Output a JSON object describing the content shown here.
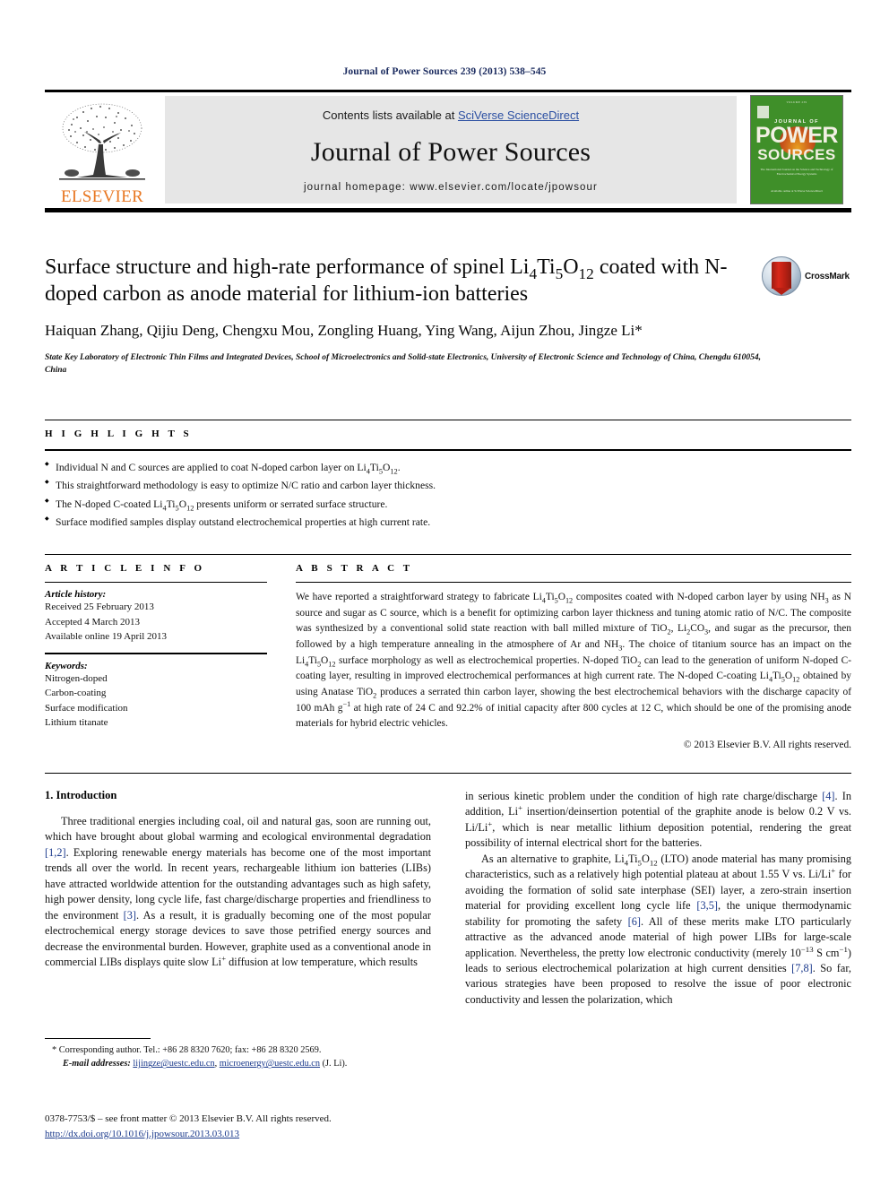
{
  "running_head": "Journal of Power Sources 239 (2013) 538–545",
  "masthead": {
    "contents_prefix": "Contents lists available at ",
    "contents_link": "SciVerse ScienceDirect",
    "journal_name": "Journal of Power Sources",
    "homepage": "journal homepage: www.elsevier.com/locate/jpowsour",
    "publisher_wordmark": "ELSEVIER",
    "cover": {
      "journal_of": "JOURNAL OF",
      "power": "POWER",
      "sources": "SOURCES",
      "blurb": "The International Journal on the Science and Technology of Electrochemical Energy Systems",
      "foot": "Available online at\nSciVerse ScienceDirect"
    }
  },
  "title": "Surface structure and high-rate performance of spinel Li4Ti5O12 coated with N-doped carbon as anode material for lithium-ion batteries",
  "authors": "Haiquan Zhang, Qijiu Deng, Chengxu Mou, Zongling Huang, Ying Wang, Aijun Zhou, Jingze Li*",
  "affiliation": "State Key Laboratory of Electronic Thin Films and Integrated Devices, School of Microelectronics and Solid-state Electronics, University of Electronic Science and Technology of China, Chengdu 610054, China",
  "crossmark_label": "CrossMark",
  "highlights": {
    "heading": "H I G H L I G H T S",
    "items": [
      "Individual N and C sources are applied to coat N-doped carbon layer on Li4Ti5O12.",
      "This straightforward methodology is easy to optimize N/C ratio and carbon layer thickness.",
      "The N-doped C-coated Li4Ti5O12 presents uniform or serrated surface structure.",
      "Surface modified samples display outstand electrochemical properties at high current rate."
    ]
  },
  "article_info": {
    "heading": "A R T I C L E   I N F O",
    "history_label": "Article history:",
    "history": [
      "Received 25 February 2013",
      "Accepted 4 March 2013",
      "Available online 19 April 2013"
    ],
    "keywords_label": "Keywords:",
    "keywords": [
      "Nitrogen-doped",
      "Carbon-coating",
      "Surface modification",
      "Lithium titanate"
    ]
  },
  "abstract": {
    "heading": "A B S T R A C T",
    "text": "We have reported a straightforward strategy to fabricate Li4Ti5O12 composites coated with N-doped carbon layer by using NH3 as N source and sugar as C source, which is a benefit for optimizing carbon layer thickness and tuning atomic ratio of N/C. The composite was synthesized by a conventional solid state reaction with ball milled mixture of TiO2, Li2CO3, and sugar as the precursor, then followed by a high temperature annealing in the atmosphere of Ar and NH3. The choice of titanium source has an impact on the Li4Ti5O12 surface morphology as well as electrochemical properties. N-doped TiO2 can lead to the generation of uniform N-doped C-coating layer, resulting in improved electrochemical performances at high current rate. The N-doped C-coating Li4Ti5O12 obtained by using Anatase TiO2 produces a serrated thin carbon layer, showing the best electrochemical behaviors with the discharge capacity of 100 mAh g-1 at high rate of 24 C and 92.2% of initial capacity after 800 cycles at 12 C, which should be one of the promising anode materials for hybrid electric vehicles.",
    "copyright": "© 2013 Elsevier B.V. All rights reserved."
  },
  "body": {
    "section_heading": "1. Introduction",
    "left_paragraph_1": "Three traditional energies including coal, oil and natural gas, soon are running out, which have brought about global warming and ecological environmental degradation [1,2]. Exploring renewable energy materials has become one of the most important trends all over the world. In recent years, rechargeable lithium ion batteries (LIBs) have attracted worldwide attention for the outstanding advantages such as high safety, high power density, long cycle life, fast charge/discharge properties and friendliness to the environment [3]. As a result, it is gradually becoming one of the most popular electrochemical energy storage devices to save those petrified energy sources and decrease the environmental burden. However, graphite used as a conventional anode in commercial LIBs displays quite slow Li+ diffusion at low temperature, which results",
    "right_paragraph_1_cont": "in serious kinetic problem under the condition of high rate charge/discharge [4]. In addition, Li+ insertion/deinsertion potential of the graphite anode is below 0.2 V vs. Li/Li+, which is near metallic lithium deposition potential, rendering the great possibility of internal electrical short for the batteries.",
    "right_paragraph_2": "As an alternative to graphite, Li4Ti5O12 (LTO) anode material has many promising characteristics, such as a relatively high potential plateau at about 1.55 V vs. Li/Li+ for avoiding the formation of solid sate interphase (SEI) layer, a zero-strain insertion material for providing excellent long cycle life [3,5], the unique thermodynamic stability for promoting the safety [6]. All of these merits make LTO particularly attractive as the advanced anode material of high power LIBs for large-scale application. Nevertheless, the pretty low electronic conductivity (merely 10-13 S cm-1) leads to serious electrochemical polarization at high current densities [7,8]. So far, various strategies have been proposed to resolve the issue of poor electronic conductivity and lessen the polarization, which"
  },
  "footnote": {
    "corresponding": "* Corresponding author. Tel.: +86 28 8320 7620; fax: +86 28 8320 2569.",
    "email_label": "E-mail addresses:",
    "email_1": "lijingze@uestc.edu.cn",
    "email_sep": ", ",
    "email_2": "microenergy@uestc.edu.cn",
    "email_suffix": " (J. Li)."
  },
  "imprint": {
    "line1": "0378-7753/$ – see front matter © 2013 Elsevier B.V. All rights reserved.",
    "doi": "http://dx.doi.org/10.1016/j.jpowsour.2013.03.013"
  },
  "colors": {
    "elsevier_orange": "#E87722",
    "link_blue": "#2b4fa2",
    "ref_blue": "#1b3a8c",
    "cover_green": "#3f8f29",
    "head_navy": "#1a2a5e"
  }
}
